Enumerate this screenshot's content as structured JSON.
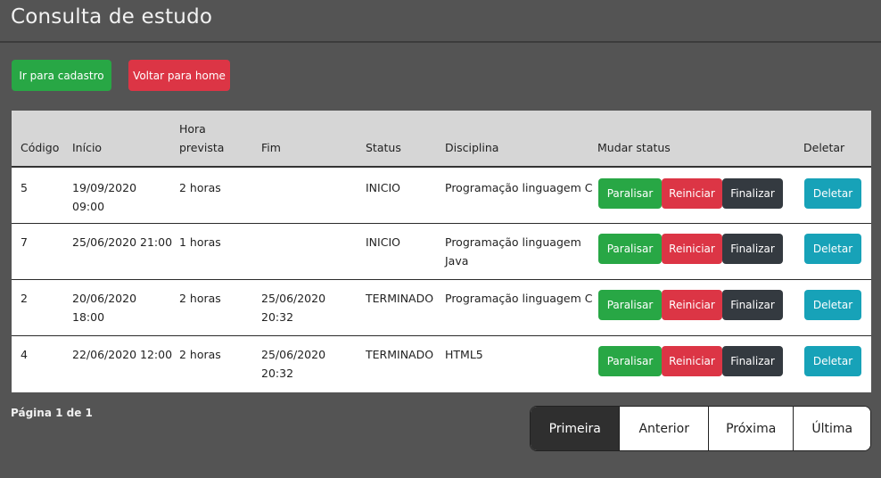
{
  "header": {
    "title": "Consulta de estudo"
  },
  "actions": {
    "cadastro_label": "Ir para cadastro",
    "home_label": "Voltar para home"
  },
  "table": {
    "columns": {
      "codigo": "Código",
      "inicio": "Início",
      "hora_prevista_1": "Hora",
      "hora_prevista_2": "prevista",
      "fim": "Fim",
      "status": "Status",
      "disciplina": "Disciplina",
      "mudar_status": "Mudar status",
      "deletar": "Deletar"
    },
    "buttons": {
      "paralisar": "Paralisar",
      "reiniciar": "Reiniciar",
      "finalizar": "Finalizar",
      "deletar": "Deletar"
    },
    "rows": [
      {
        "codigo": "5",
        "inicio_1": "19/09/2020",
        "inicio_2": "09:00",
        "hora": "2 horas",
        "fim_1": "",
        "fim_2": "",
        "status": "INICIO",
        "disciplina_1": "Programação linguagem C",
        "disciplina_2": ""
      },
      {
        "codigo": "7",
        "inicio_1": "25/06/2020 21:00",
        "inicio_2": "",
        "hora": "1 horas",
        "fim_1": "",
        "fim_2": "",
        "status": "INICIO",
        "disciplina_1": "Programação linguagem",
        "disciplina_2": "Java"
      },
      {
        "codigo": "2",
        "inicio_1": "20/06/2020",
        "inicio_2": "18:00",
        "hora": "2 horas",
        "fim_1": "25/06/2020",
        "fim_2": "20:32",
        "status": "TERMINADO",
        "disciplina_1": "Programação linguagem C",
        "disciplina_2": ""
      },
      {
        "codigo": "4",
        "inicio_1": "22/06/2020 12:00",
        "inicio_2": "",
        "hora": "2 horas",
        "fim_1": "25/06/2020",
        "fim_2": "20:32",
        "status": "TERMINADO",
        "disciplina_1": "HTML5",
        "disciplina_2": ""
      }
    ]
  },
  "pagination": {
    "info": "Página 1 de 1",
    "first": "Primeira",
    "prev": "Anterior",
    "next": "Próxima",
    "last": "Última"
  },
  "colors": {
    "green": "#28a745",
    "red": "#dc3545",
    "dark": "#343a40",
    "teal": "#17a2b8"
  }
}
